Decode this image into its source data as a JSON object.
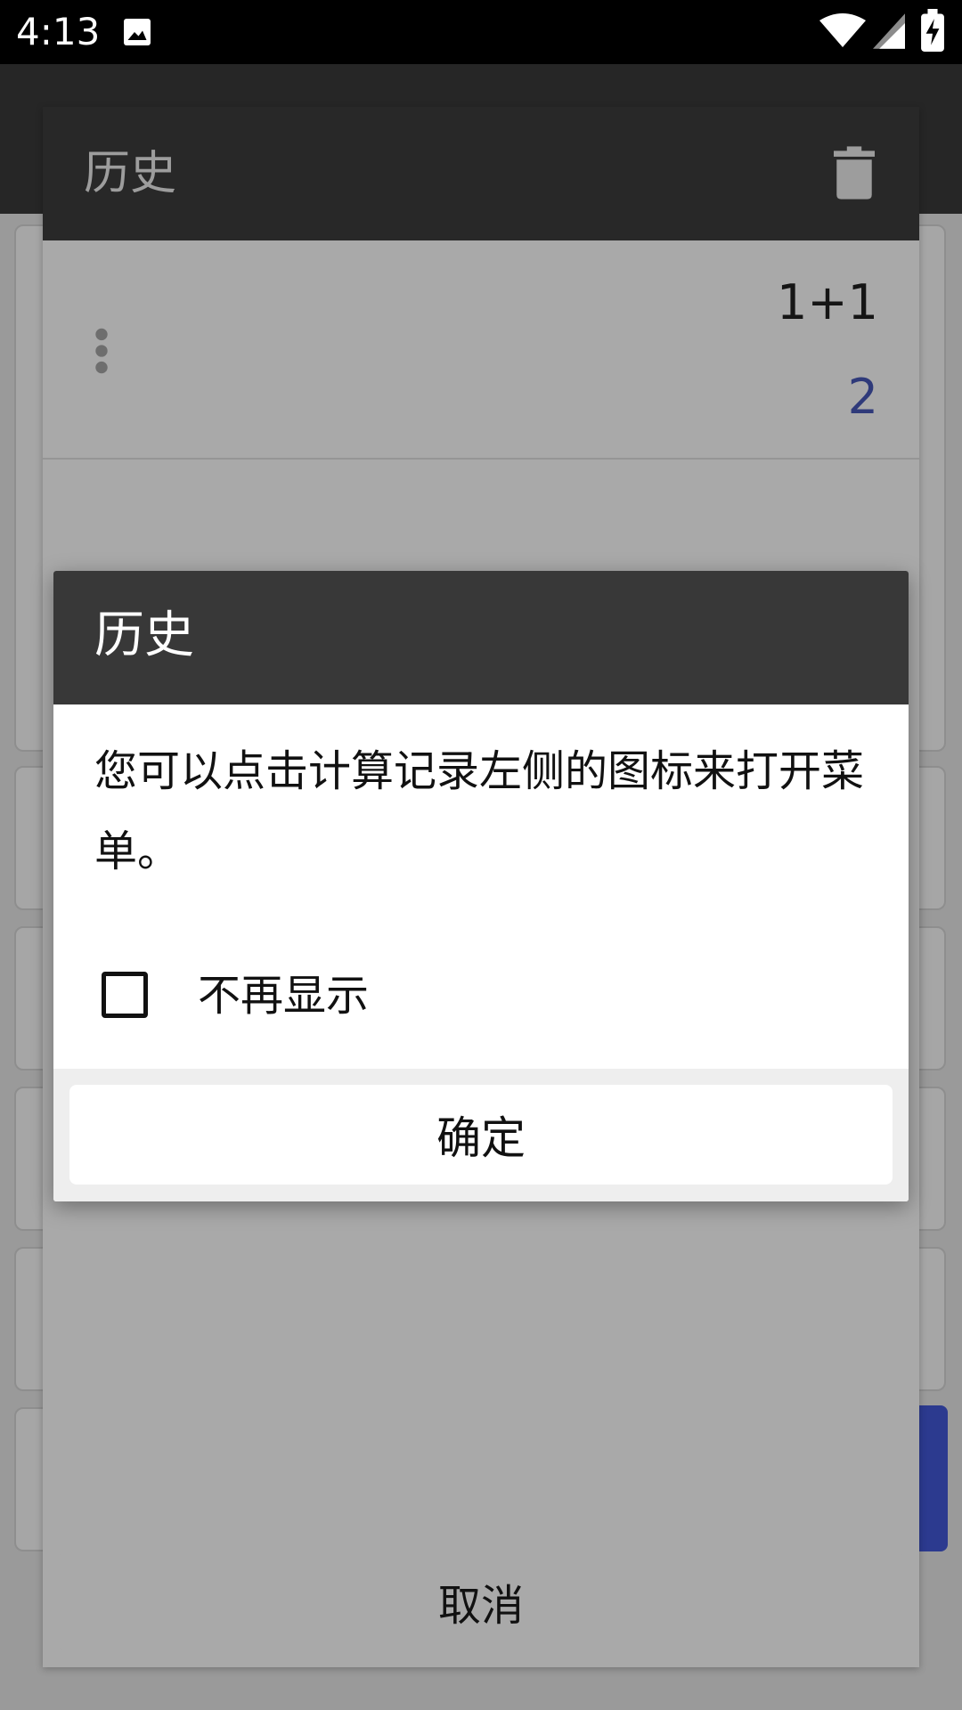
{
  "status_bar": {
    "time": "4:13"
  },
  "history": {
    "title": "历史",
    "entries": [
      {
        "expression": "1+1",
        "result": "2"
      }
    ],
    "cancel_label": "取消"
  },
  "dialog": {
    "title": "历史",
    "message": "您可以点击计算记录左侧的图标来打开菜单。",
    "checkbox_label": "不再显示",
    "checkbox_checked": false,
    "ok_label": "确定"
  },
  "colors": {
    "result_text": "#2f3a7a",
    "dialog_header": "#383838",
    "accent": "#2c3a8f"
  }
}
